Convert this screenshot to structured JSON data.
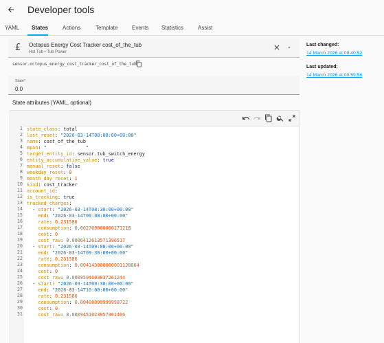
{
  "header": {
    "title": "Developer tools"
  },
  "tabs": [
    "YAML",
    "States",
    "Actions",
    "Template",
    "Events",
    "Statistics",
    "Assist"
  ],
  "entity": {
    "name": "Octopus Energy Cost Tracker cost_of_the_tub",
    "subtitle": "Hot Tub • Tub Power",
    "entity_id": "sensor.octopus_energy_cost_tracker_cost_of_the_tub"
  },
  "state": {
    "label": "State*",
    "value": "0.0"
  },
  "attributes_title": "State attributes (YAML, optional)",
  "side": {
    "last_changed_label": "Last changed:",
    "last_changed_value": "14 March 2026 at 08:40:52",
    "last_updated_label": "Last updated:",
    "last_updated_value": "14 March 2026 at 09:59:56"
  },
  "code_lines": [
    [
      [
        "k",
        "state_class"
      ],
      [
        "v",
        ": total"
      ]
    ],
    [
      [
        "k",
        "last_reset"
      ],
      [
        "v",
        ": "
      ],
      [
        "s",
        "\"2026-03-14T00:00:00+00:00\""
      ]
    ],
    [
      [
        "k",
        "name"
      ],
      [
        "v",
        ": cost_of_the_tub"
      ]
    ],
    [
      [
        "k",
        "mpan"
      ],
      [
        "v",
        ": "
      ],
      [
        "s",
        "\"              \""
      ]
    ],
    [
      [
        "k",
        "target_entity_id"
      ],
      [
        "v",
        ": sensor.tub_switch_energy"
      ]
    ],
    [
      [
        "k",
        "entity_accumulative_value"
      ],
      [
        "v",
        ": "
      ],
      [
        "b",
        "true"
      ]
    ],
    [
      [
        "k",
        "manual_reset"
      ],
      [
        "v",
        ": "
      ],
      [
        "b",
        "false"
      ]
    ],
    [
      [
        "k",
        "weekday_reset"
      ],
      [
        "v",
        ": "
      ],
      [
        "n",
        "0"
      ]
    ],
    [
      [
        "k",
        "month_day_reset"
      ],
      [
        "v",
        ": "
      ],
      [
        "n",
        "1"
      ]
    ],
    [
      [
        "k",
        "kind"
      ],
      [
        "v",
        ": cost_tracker"
      ]
    ],
    [
      [
        "k",
        "account_id"
      ],
      [
        "v",
        ":"
      ]
    ],
    [
      [
        "k",
        "is_tracking"
      ],
      [
        "v",
        ": "
      ],
      [
        "b",
        "true"
      ]
    ],
    [
      [
        "k",
        "tracked_charges"
      ],
      [
        "v",
        ":"
      ]
    ],
    [
      [
        "v",
        "  - "
      ],
      [
        "k",
        "start"
      ],
      [
        "v",
        ": "
      ],
      [
        "s",
        "\"2026-03-14T08:30:00+00:00\""
      ]
    ],
    [
      [
        "v",
        "    "
      ],
      [
        "k",
        "end"
      ],
      [
        "v",
        ": "
      ],
      [
        "s",
        "\"2026-03-14T09:00:00+00:00\""
      ]
    ],
    [
      [
        "v",
        "    "
      ],
      [
        "k",
        "rate"
      ],
      [
        "v",
        ": "
      ],
      [
        "n",
        "0.231586"
      ]
    ],
    [
      [
        "v",
        "    "
      ],
      [
        "k",
        "consumption"
      ],
      [
        "v",
        ": "
      ],
      [
        "n",
        "0.002769000000171218"
      ]
    ],
    [
      [
        "v",
        "    "
      ],
      [
        "k",
        "cost"
      ],
      [
        "v",
        ": "
      ],
      [
        "n",
        "0"
      ]
    ],
    [
      [
        "v",
        "    "
      ],
      [
        "k",
        "cost_raw"
      ],
      [
        "v",
        ": "
      ],
      [
        "n",
        "0.0006412613571396517"
      ]
    ],
    [
      [
        "v",
        "  - "
      ],
      [
        "k",
        "start"
      ],
      [
        "v",
        ": "
      ],
      [
        "s",
        "\"2026-03-14T09:00:00+00:00\""
      ]
    ],
    [
      [
        "v",
        "    "
      ],
      [
        "k",
        "end"
      ],
      [
        "v",
        ": "
      ],
      [
        "s",
        "\"2026-03-14T09:30:00+00:00\""
      ]
    ],
    [
      [
        "v",
        "    "
      ],
      [
        "k",
        "rate"
      ],
      [
        "v",
        ": "
      ],
      [
        "n",
        "0.231586"
      ]
    ],
    [
      [
        "v",
        "    "
      ],
      [
        "k",
        "consumption"
      ],
      [
        "v",
        ": "
      ],
      [
        "n",
        "0.004143000000001128064"
      ]
    ],
    [
      [
        "v",
        "    "
      ],
      [
        "k",
        "cost"
      ],
      [
        "v",
        ": "
      ],
      [
        "n",
        "0"
      ]
    ],
    [
      [
        "v",
        "    "
      ],
      [
        "k",
        "cost_raw"
      ],
      [
        "v",
        ": "
      ],
      [
        "n",
        "0.0009594603837261244"
      ]
    ],
    [
      [
        "v",
        "  - "
      ],
      [
        "k",
        "start"
      ],
      [
        "v",
        ": "
      ],
      [
        "s",
        "\"2026-03-14T09:30:00+00:00\""
      ]
    ],
    [
      [
        "v",
        "    "
      ],
      [
        "k",
        "end"
      ],
      [
        "v",
        ": "
      ],
      [
        "s",
        "\"2026-03-14T10:00:00+00:00\""
      ]
    ],
    [
      [
        "v",
        "    "
      ],
      [
        "k",
        "rate"
      ],
      [
        "v",
        ": "
      ],
      [
        "n",
        "0.231586"
      ]
    ],
    [
      [
        "v",
        "    "
      ],
      [
        "k",
        "consumption"
      ],
      [
        "v",
        ": "
      ],
      [
        "n",
        "0.00408099999958722"
      ]
    ],
    [
      [
        "v",
        "    "
      ],
      [
        "k",
        "cost"
      ],
      [
        "v",
        ": "
      ],
      [
        "n",
        "0"
      ]
    ],
    [
      [
        "v",
        "    "
      ],
      [
        "k",
        "cost_raw"
      ],
      [
        "v",
        ": "
      ],
      [
        "n",
        "0.0009451023957301406"
      ]
    ]
  ],
  "fold_lines": [
    14,
    20,
    26
  ],
  "icons": {
    "back": "arrow-left-icon",
    "entity": "currency-gbp-icon",
    "clear": "close-icon",
    "caret": "menu-down-icon",
    "copy": "content-copy-icon",
    "undo": "undo-icon",
    "redo": "redo-icon",
    "copy_code": "copy-icon",
    "search": "search-icon",
    "fullscreen": "fullscreen-icon"
  },
  "colors": {
    "accent": "#03a9f4",
    "link": "#039be5"
  }
}
